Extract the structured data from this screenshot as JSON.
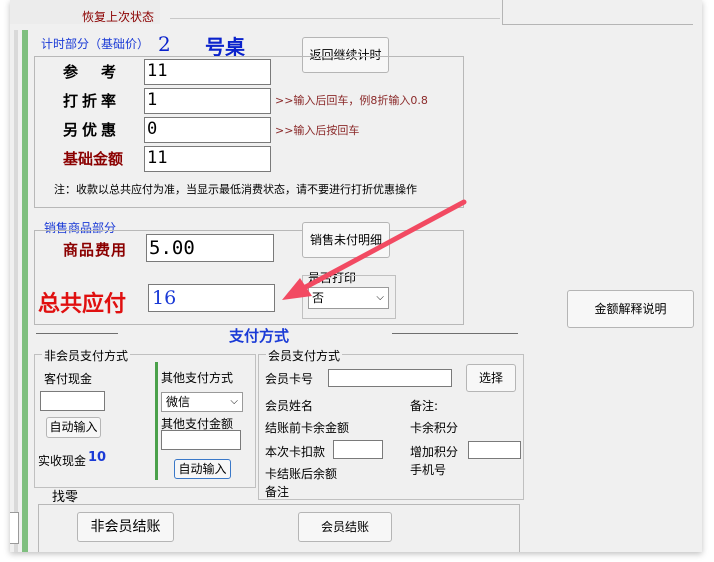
{
  "top": {
    "restore_label": "恢复上次状态"
  },
  "timing": {
    "section_label": "计时部分（基础价）",
    "table_number": "2",
    "table_unit": "号桌",
    "return_button": "返回继续计时",
    "reference_label": "参　考",
    "reference_value": "11",
    "discount_label": "打折率",
    "discount_value": "1",
    "discount_hint": ">>输入后回车，例8折输入0.8",
    "extra_discount_label": "另优惠",
    "extra_discount_value": "0",
    "extra_discount_hint": ">>输入后按回车",
    "base_amount_label": "基础金额",
    "base_amount_value": "11",
    "note": "注：收款以总共应付为准，当显示最低消费状态，请不要进行打折优惠操作"
  },
  "sales": {
    "section_label": "销售商品部分",
    "goods_fee_label": "商品费用",
    "goods_fee_value": "5.00",
    "unpaid_detail_button": "销售未付明细"
  },
  "total": {
    "label": "总共应付",
    "value": "16",
    "print_label": "是否打印",
    "print_option": "否",
    "amount_explain_button": "金额解释说明",
    "payment_method_label": "支付方式"
  },
  "non_member": {
    "section_label": "非会员支付方式",
    "cash_label": "客付现金",
    "cash_value": "",
    "auto_input_button": "自动输入",
    "actual_cash_label": "实收现金",
    "actual_cash_value": "10",
    "other_label": "其他支付方式",
    "other_option": "微信",
    "other_amount_label": "其他支付金额",
    "other_amount_value": "",
    "other_auto_input_button": "自动输入",
    "change_label": "找零"
  },
  "member": {
    "section_label": "会员支付方式",
    "card_label": "会员卡号",
    "card_value": "",
    "select_button": "选择",
    "name_label": "会员姓名",
    "remark_label": "备注:",
    "balance_before_label": "结账前卡余金额",
    "card_balance_label": "卡余积分",
    "deduct_label": "本次卡扣款",
    "deduct_value": "",
    "add_points_label": "增加积分",
    "add_points_value": "",
    "balance_after_label": "卡结账后余额",
    "phone_label": "手机号",
    "remark2_label": "备注"
  },
  "footer": {
    "non_member_checkout_button": "非会员结账",
    "member_checkout_button": "会员结账"
  }
}
